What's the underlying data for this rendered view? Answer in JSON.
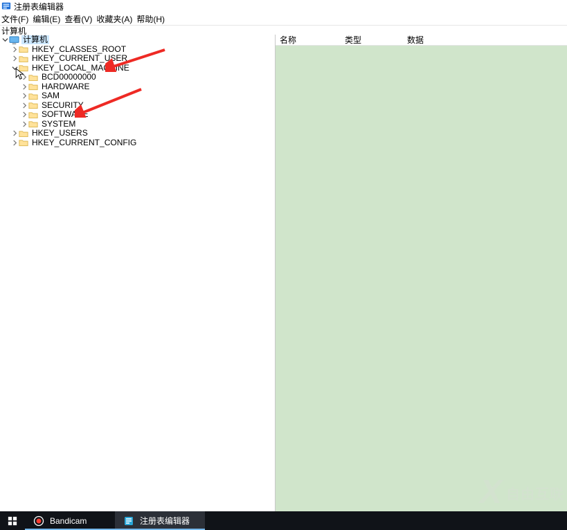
{
  "window": {
    "title": "注册表编辑器"
  },
  "menubar": {
    "file": "文件(F)",
    "edit": "编辑(E)",
    "view": "查看(V)",
    "fav": "收藏夹(A)",
    "help": "帮助(H)"
  },
  "pathbar": {
    "text": "计算机"
  },
  "tree": {
    "root": "计算机",
    "nodes": {
      "hkcr": "HKEY_CLASSES_ROOT",
      "hkcu": "HKEY_CURRENT_USER",
      "hklm": "HKEY_LOCAL_MACHINE",
      "hku": "HKEY_USERS",
      "hkcc": "HKEY_CURRENT_CONFIG"
    },
    "hklm_children": {
      "bcd": "BCD00000000",
      "hardware": "HARDWARE",
      "sam": "SAM",
      "security": "SECURITY",
      "software": "SOFTWARE",
      "system": "SYSTEM"
    }
  },
  "details": {
    "cols": {
      "name": "名称",
      "type": "类型",
      "data": "数据"
    }
  },
  "taskbar": {
    "bandicam": "Bandicam",
    "regedit": "注册表编辑器"
  },
  "watermark": {
    "text": "自由互联"
  },
  "colors": {
    "arrow": "#ee2a24",
    "rightPanel": "#d0e5cb",
    "taskbar": "#101318",
    "selection": "#cde8ff"
  }
}
